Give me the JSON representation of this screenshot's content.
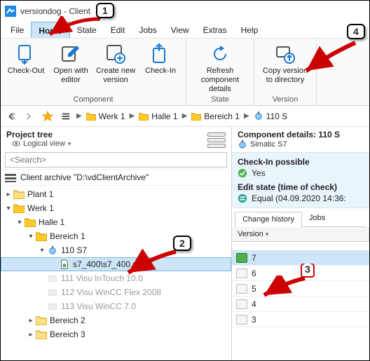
{
  "window": {
    "title": "versiondog - Client"
  },
  "menu": {
    "file": "File",
    "home": "Home",
    "state": "State",
    "edit": "Edit",
    "jobs": "Jobs",
    "view": "View",
    "extras": "Extras",
    "help": "Help"
  },
  "ribbon": {
    "checkout": "Check-Out",
    "open_editor": "Open with editor",
    "create_version": "Create new version",
    "checkin": "Check-In",
    "group_component": "Component",
    "refresh": "Refresh component details",
    "group_state": "State",
    "copy_version": "Copy version to directory",
    "group_version": "Version"
  },
  "breadcrumb": {
    "items": [
      "Werk 1",
      "Halle 1",
      "Bereich 1",
      "110 S"
    ]
  },
  "project_tree": {
    "title": "Project tree",
    "view_mode": "Logical view",
    "search_placeholder": "<Search>",
    "archive_label": "Client archive \"D:\\vdClientArchive\"",
    "nodes": {
      "plant1": "Plant 1",
      "werk1": "Werk 1",
      "halle1": "Halle 1",
      "bereich1": "Bereich 1",
      "s7": "110 S7",
      "s7file": "s7_400\\s7_400.s7p",
      "intouch": "111 Visu InTouch 10.0",
      "winccflex": "112 Visu WinCC Flex 2008",
      "wincc7": "113 Visu WinCC 7.0",
      "bereich2": "Bereich 2",
      "bereich3": "Bereich 3"
    }
  },
  "details": {
    "title": "Component details: 110 S",
    "type": "Simatic S7",
    "checkin_label": "Check-In possible",
    "checkin_value": "Yes",
    "edit_state_label": "Edit state (time of check)",
    "edit_state_value": "Equal (04.09.2020 14:36:",
    "tabs": {
      "history": "Change history",
      "jobs": "Jobs"
    },
    "version_col": "Version",
    "versions": [
      "7",
      "6",
      "5",
      "4",
      "3"
    ]
  },
  "annotations": {
    "b1": "1",
    "b2": "2",
    "b3": "3",
    "b4": "4"
  }
}
